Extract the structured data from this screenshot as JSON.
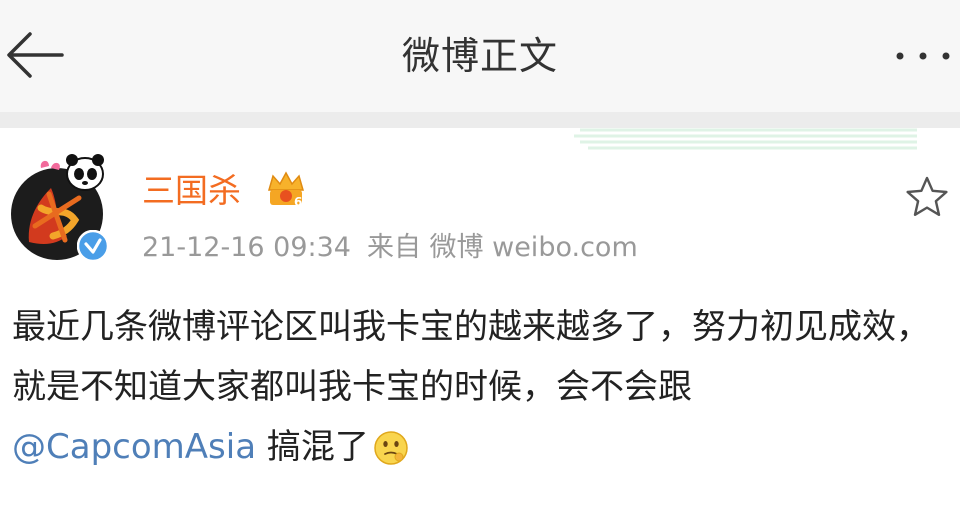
{
  "header": {
    "title": "微博正文",
    "back_icon": "back-arrow-icon",
    "more_icon": "more-dots-icon"
  },
  "post": {
    "author": {
      "name": "三国杀",
      "avatar_icon": "avatar-image",
      "vip_icon": "crown-badge-icon",
      "verified_icon": "verified-badge-icon"
    },
    "time": "21-12-16 09:34",
    "source": "来自 微博 weibo.com",
    "star_icon": "star-outline-icon",
    "text_before_mention": "最近几条微博评论区叫我卡宝的越来越多了，努力初见成效，就是不知道大家都叫我卡宝的时候，会不会跟",
    "mention": "@CapcomAsia",
    "text_after_mention": " 搞混了",
    "emoji_icon": "thinking-face-emoji-icon"
  },
  "colors": {
    "username": "#f36c21",
    "mention": "#4f7fb8",
    "meta": "#999999",
    "verified": "#4a9ee8"
  }
}
